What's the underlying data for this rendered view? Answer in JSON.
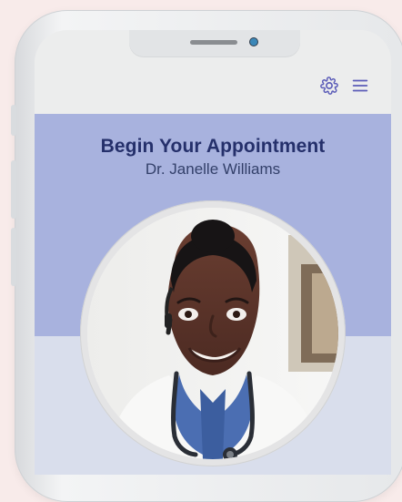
{
  "appointment": {
    "title": "Begin Your Appointment",
    "doctor_name": "Dr. Janelle Williams"
  },
  "header": {
    "settings_icon": "gear-icon",
    "menu_icon": "hamburger-menu-icon"
  },
  "colors": {
    "page_background": "#f8ebea",
    "hero_background": "#a8b2de",
    "hero_lower_background": "#d9deec",
    "title_text": "#25306b",
    "accent_icon": "#5b5cb8"
  }
}
